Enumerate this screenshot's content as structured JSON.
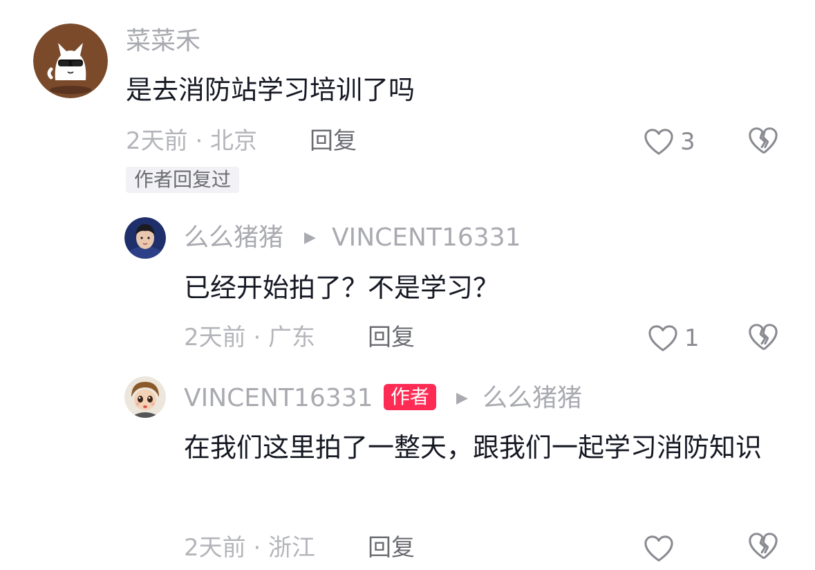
{
  "comments": [
    {
      "username": "菜菜禾",
      "content": "是去消防站学习培训了吗",
      "time_location": "2天前 · 北京",
      "reply_label": "回复",
      "like_count": "3",
      "chip": "作者回复过"
    },
    {
      "username": "么么猪猪",
      "reply_to": "VINCENT16331",
      "content": "已经开始拍了？不是学习？",
      "time_location": "2天前 · 广东",
      "reply_label": "回复",
      "like_count": "1"
    },
    {
      "username": "VINCENT16331",
      "badge": "作者",
      "reply_to": "么么猪猪",
      "content": "在我们这里拍了一整天，跟我们一起学习消防知识",
      "time_location": "2天前 · 浙江",
      "reply_label": "回复"
    }
  ],
  "icons": {
    "like": "heart-outline-icon",
    "dislike": "broken-heart-icon",
    "reply_arrow": "triangle-right-icon"
  },
  "colors": {
    "author_badge": "#fe2c55",
    "muted_text": "#a9aab0",
    "primary_text": "#161823"
  }
}
